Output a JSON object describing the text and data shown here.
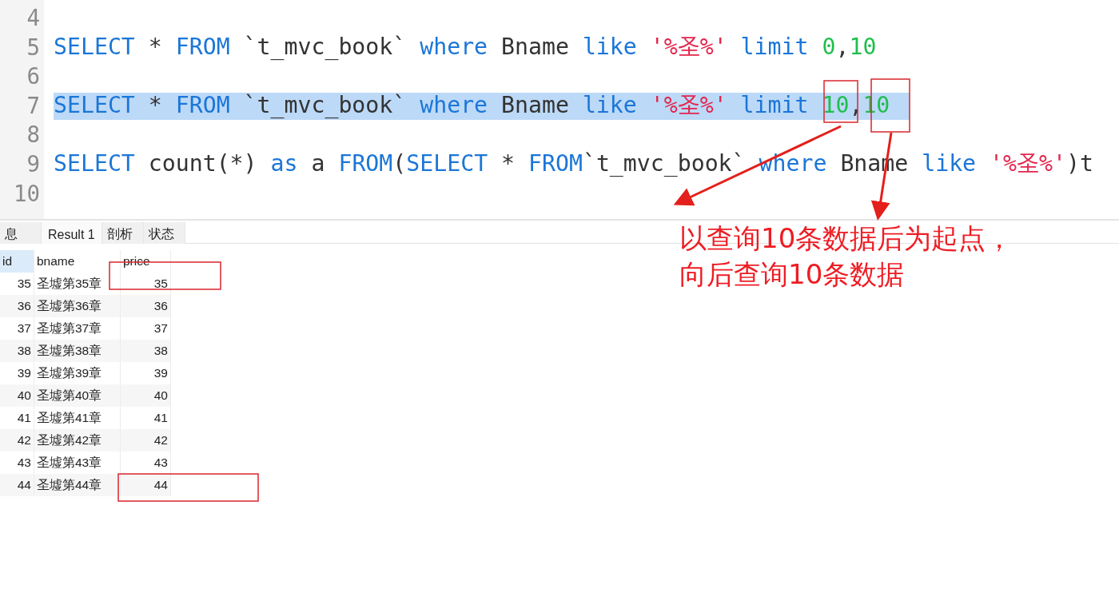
{
  "editor": {
    "lines": [
      {
        "number": "4",
        "selected": false
      },
      {
        "number": "5",
        "selected": false,
        "tokens": [
          {
            "text": "SELECT",
            "kind": "keyword"
          },
          {
            "text": " * ",
            "kind": "plain"
          },
          {
            "text": "FROM",
            "kind": "keyword"
          },
          {
            "text": " `t_mvc_book` ",
            "kind": "plain"
          },
          {
            "text": "where",
            "kind": "keyword"
          },
          {
            "text": " Bname ",
            "kind": "plain"
          },
          {
            "text": "like ",
            "kind": "keyword"
          },
          {
            "text": "'%圣%' ",
            "kind": "string"
          },
          {
            "text": "limit ",
            "kind": "keyword"
          },
          {
            "text": "0",
            "kind": "number"
          },
          {
            "text": ",",
            "kind": "plain"
          },
          {
            "text": "10",
            "kind": "number"
          }
        ]
      },
      {
        "number": "6",
        "selected": false
      },
      {
        "number": "7",
        "selected": true,
        "tokens": [
          {
            "text": "SELECT",
            "kind": "keyword"
          },
          {
            "text": " * ",
            "kind": "plain"
          },
          {
            "text": "FROM",
            "kind": "keyword"
          },
          {
            "text": " `t_mvc_book` ",
            "kind": "plain"
          },
          {
            "text": "where",
            "kind": "keyword"
          },
          {
            "text": " Bname ",
            "kind": "plain"
          },
          {
            "text": "like ",
            "kind": "keyword"
          },
          {
            "text": "'%圣%' ",
            "kind": "string"
          },
          {
            "text": "limit ",
            "kind": "keyword"
          },
          {
            "text": "10",
            "kind": "number"
          },
          {
            "text": ",",
            "kind": "plain"
          },
          {
            "text": "10",
            "kind": "number"
          }
        ]
      },
      {
        "number": "8",
        "selected": false
      },
      {
        "number": "9",
        "selected": false,
        "tokens": [
          {
            "text": "SELECT",
            "kind": "keyword"
          },
          {
            "text": " count(*) ",
            "kind": "plain"
          },
          {
            "text": "as",
            "kind": "keyword"
          },
          {
            "text": " a ",
            "kind": "plain"
          },
          {
            "text": "FROM",
            "kind": "keyword"
          },
          {
            "text": "(",
            "kind": "plain"
          },
          {
            "text": "SELECT",
            "kind": "keyword"
          },
          {
            "text": " * ",
            "kind": "plain"
          },
          {
            "text": "FROM",
            "kind": "keyword"
          },
          {
            "text": "`t_mvc_book` ",
            "kind": "plain"
          },
          {
            "text": "where",
            "kind": "keyword"
          },
          {
            "text": " Bname ",
            "kind": "plain"
          },
          {
            "text": "like ",
            "kind": "keyword"
          },
          {
            "text": "'%圣%'",
            "kind": "string"
          },
          {
            "text": ")t",
            "kind": "plain"
          }
        ]
      },
      {
        "number": "10",
        "selected": false
      }
    ]
  },
  "result_tabs": [
    {
      "label": "息",
      "selected": false
    },
    {
      "label": "Result 1",
      "selected": true
    },
    {
      "label": "剖析",
      "selected": false
    },
    {
      "label": "状态",
      "selected": false
    }
  ],
  "table": {
    "columns": [
      "id",
      "bname",
      "price"
    ],
    "rows": [
      [
        "35",
        "圣墟第35章",
        "35"
      ],
      [
        "36",
        "圣墟第36章",
        "36"
      ],
      [
        "37",
        "圣墟第37章",
        "37"
      ],
      [
        "38",
        "圣墟第38章",
        "38"
      ],
      [
        "39",
        "圣墟第39章",
        "39"
      ],
      [
        "40",
        "圣墟第40章",
        "40"
      ],
      [
        "41",
        "圣墟第41章",
        "41"
      ],
      [
        "42",
        "圣墟第42章",
        "42"
      ],
      [
        "43",
        "圣墟第43章",
        "43"
      ],
      [
        "44",
        "圣墟第44章",
        "44"
      ]
    ]
  },
  "annotation": {
    "lines": [
      "以查询10条数据后为起点，",
      "向后查询10条数据"
    ]
  }
}
